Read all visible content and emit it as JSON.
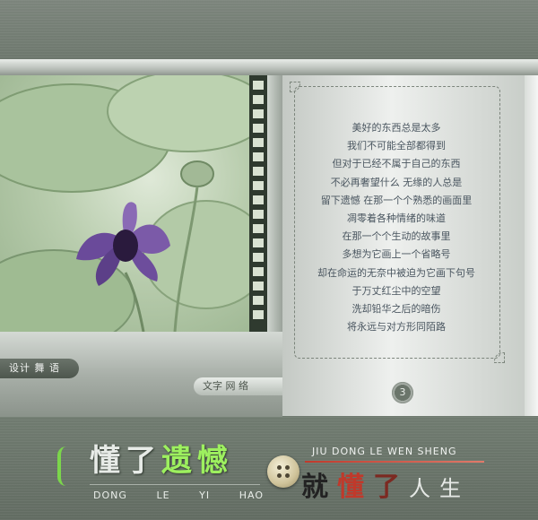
{
  "poem": {
    "lines": [
      "美好的东西总是太多",
      "我们不可能全部都得到",
      "但对于已经不属于自己的东西",
      "不必再奢望什么  无缘的人总是",
      "留下遗憾  在那一个个熟悉的画面里",
      "凋零着各种情绪的味道",
      "在那一个个生动的故事里",
      "多想为它画上一个省略号",
      "却在命运的无奈中被迫为它画下句号",
      "于万丈红尘中的空望",
      "洗却铅华之后的暗伤",
      "将永远与对方形同陌路"
    ]
  },
  "tags": {
    "design": "设计 舞 语",
    "credit": "文字  网 络"
  },
  "page_number": "3",
  "title": {
    "cn_plain": "懂了",
    "cn_accent": "遗憾",
    "en": [
      "DONG",
      "LE",
      "YI",
      "HAO"
    ]
  },
  "subtitle": {
    "en": "JIU DONG LE WEN SHENG",
    "cn": [
      "就",
      "懂",
      "了",
      "人",
      "生"
    ]
  },
  "colors": {
    "accent_green": "#9df05f",
    "accent_red": "#c0392b",
    "poem_text": "#4a5660"
  }
}
